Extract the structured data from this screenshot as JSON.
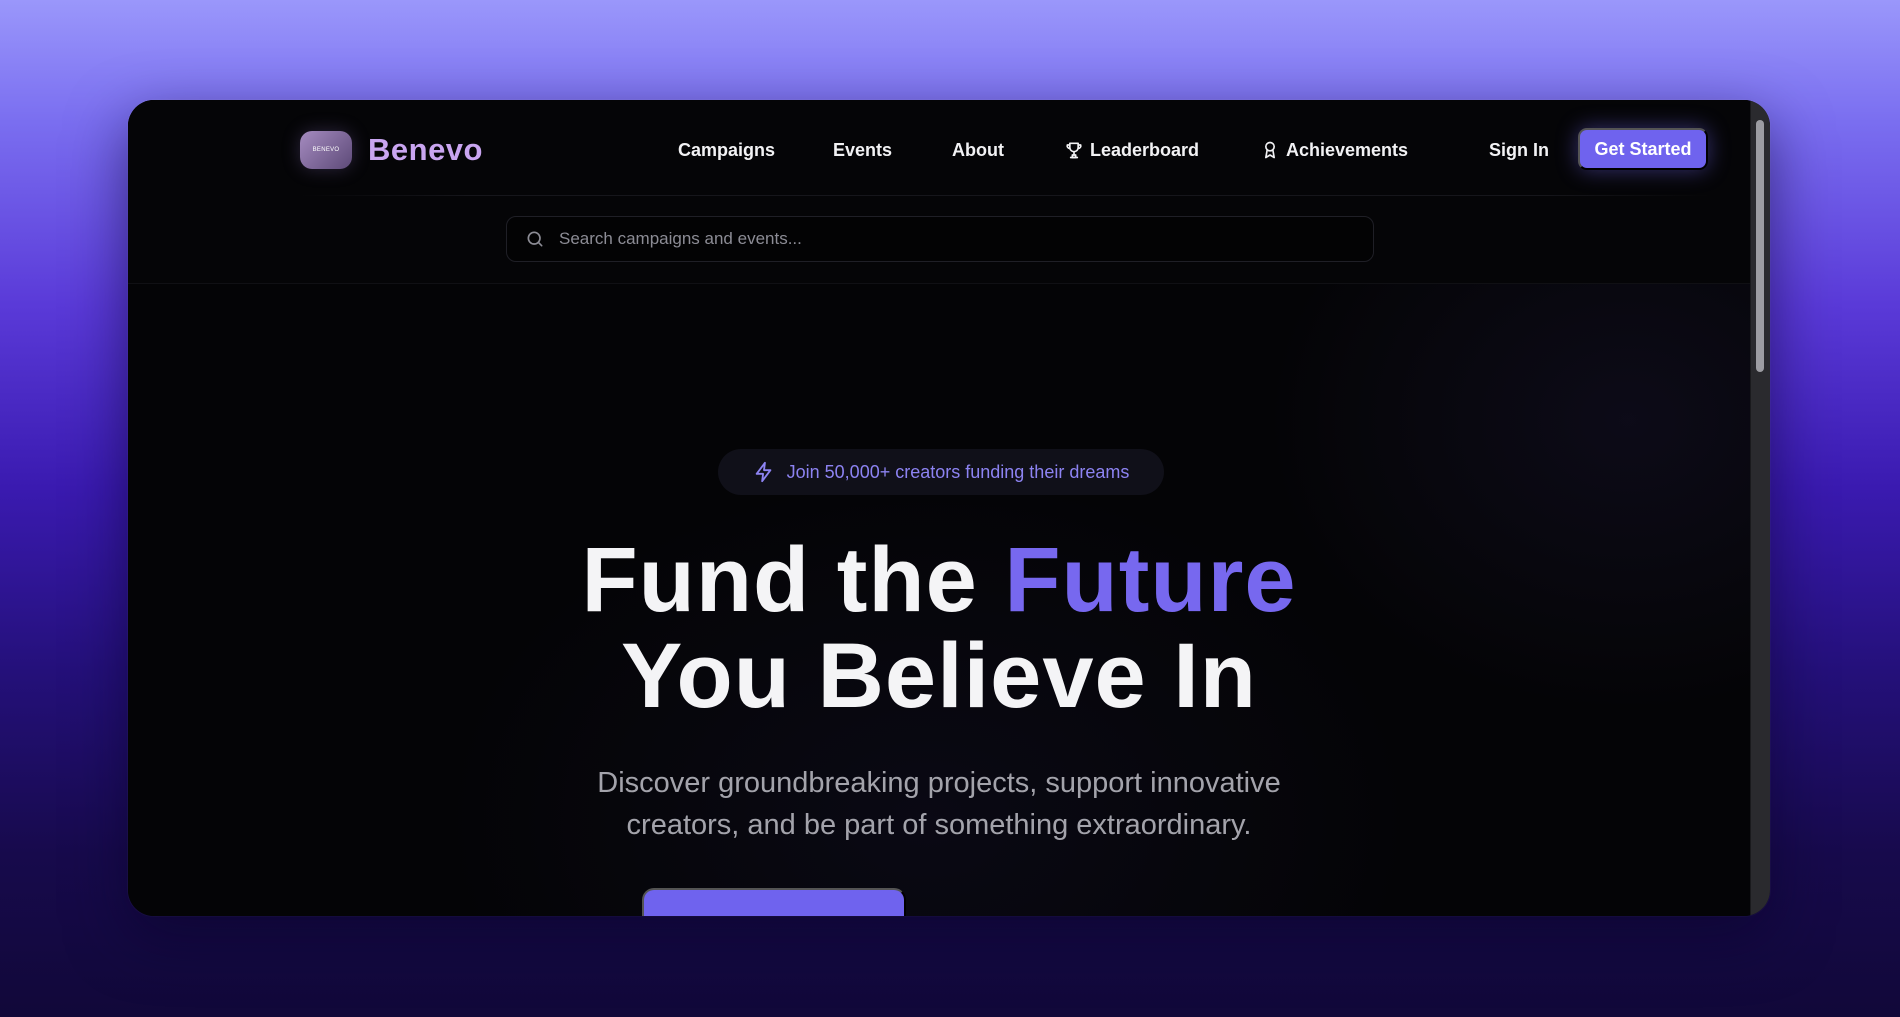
{
  "brand": {
    "logo_text": "BENEVO",
    "name": "Benevo"
  },
  "nav": {
    "links": [
      {
        "label": "Campaigns",
        "icon": ""
      },
      {
        "label": "Events",
        "icon": ""
      },
      {
        "label": "About",
        "icon": ""
      },
      {
        "label": "Leaderboard",
        "icon": "trophy-icon"
      },
      {
        "label": "Achievements",
        "icon": "award-icon"
      }
    ],
    "signin_label": "Sign In",
    "cta_label": "Get Started"
  },
  "search": {
    "placeholder": "Search campaigns and events..."
  },
  "hero": {
    "badge_text": "Join 50,000+ creators funding their dreams",
    "headline_part1": "Fund the ",
    "headline_accent": "Future",
    "headline_line2": "You Believe In",
    "subtitle_line1": "Discover groundbreaking projects, support innovative",
    "subtitle_line2": "creators, and be part of something extraordinary."
  },
  "colors": {
    "accent": "#6f63ee",
    "brand": "#c9a5f0",
    "background": "#040406"
  }
}
